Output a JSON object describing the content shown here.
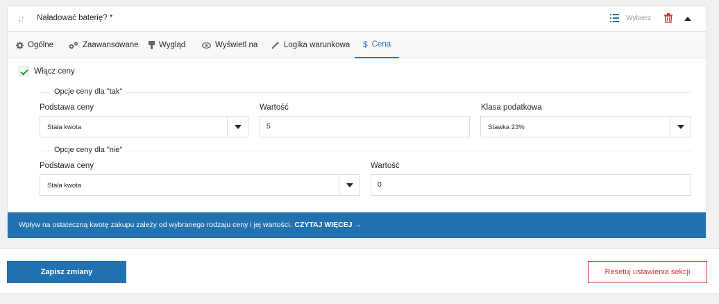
{
  "field": {
    "title": "Naładować baterię? *",
    "choose_label": "Wybierz"
  },
  "tabs": [
    {
      "label": "Ogólne",
      "icon": "gear-icon"
    },
    {
      "label": "Zaawansowane",
      "icon": "gears-icon"
    },
    {
      "label": "Wygląd",
      "icon": "paintbrush-icon"
    },
    {
      "label": "Wyświetl na",
      "icon": "eye-icon"
    },
    {
      "label": "Logika warunkowa",
      "icon": "magic-wand-icon"
    },
    {
      "label": "Cena",
      "icon": "dollar-icon"
    }
  ],
  "active_tab": "Cena",
  "enable_prices": {
    "label": "Włącz ceny",
    "checked": true
  },
  "options_yes": {
    "legend": "Opcje ceny dla \"tak\"",
    "price_basis_label": "Podstawa ceny",
    "price_basis_value": "Stała kwota",
    "value_label": "Wartość",
    "value": "5",
    "tax_class_label": "Klasa podatkowa",
    "tax_class_value": "Stawka 23%"
  },
  "options_no": {
    "legend": "Opcje ceny dla \"nie\"",
    "price_basis_label": "Podstawa ceny",
    "price_basis_value": "Stała kwota",
    "value_label": "Wartość",
    "value": "0"
  },
  "info": {
    "text": "Wpływ na ostateczną kwotę zakupu zależy od wybranego rodzaju ceny i jej wartości.",
    "link": "CZYTAJ WIĘCEJ →"
  },
  "footer": {
    "save_label": "Zapisz zmiany",
    "reset_label": "Resetuj ustawienia sekcji"
  },
  "colors": {
    "accent": "#2271b1",
    "danger": "#d63638",
    "check": "#00a32a"
  }
}
